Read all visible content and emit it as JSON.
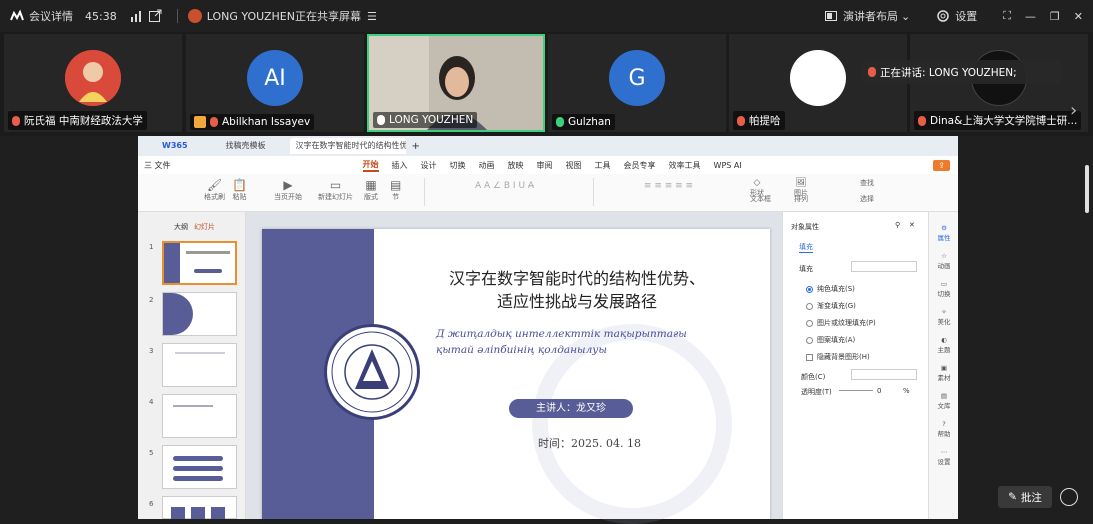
{
  "topbar": {
    "meeting_details": "会议详情",
    "timer": "45:38",
    "sharing_status": "LONG YOUZHEN正在共享屏幕",
    "layout_label": "演讲者布局",
    "settings_label": "设置"
  },
  "participants": [
    {
      "name": "阮氏福 中南财经政法大学",
      "initials": "",
      "avatar_color": "#c9402f"
    },
    {
      "name": "Abilkhan Issayev",
      "initials": "AI",
      "avatar_color": "#2f6fcd"
    },
    {
      "name": "LONG YOUZHEN",
      "initials": "",
      "avatar_color": "#7b7369"
    },
    {
      "name": "Gulzhan",
      "initials": "G",
      "avatar_color": "#2f6fcd"
    },
    {
      "name": "帕提哈",
      "initials": "",
      "avatar_color": "#ffffff"
    },
    {
      "name": "Dina&上海大学文学院博士研...",
      "initials": "",
      "avatar_color": "#111111"
    }
  ],
  "speaking_label": "正在讲话:  LONG YOUZHEN;",
  "wps": {
    "tabs": [
      "W365",
      "找稿壳模板",
      "汉字在数字智能时代的结构性优势"
    ],
    "menu": [
      "三 文件",
      "开始",
      "插入",
      "设计",
      "切换",
      "动画",
      "放映",
      "审阅",
      "视图",
      "工具",
      "会员专享",
      "效率工具",
      "WPS AI"
    ],
    "active_menu": "开始",
    "ribbon": [
      "格式刷",
      "粘贴",
      "当页开始",
      "新建幻灯片",
      "版式",
      "节",
      "形状",
      "图片",
      "文本框",
      "排列",
      "查找",
      "选择"
    ],
    "left_tabs": [
      "大纲",
      "幻灯片"
    ],
    "slide_numbers": [
      "1",
      "2",
      "3",
      "4",
      "5",
      "6"
    ]
  },
  "slide": {
    "title_line1": "汉字在数字智能时代的结构性优势、",
    "title_line2": "适应性挑战与发展路径",
    "kz_line1": "Д   жиҭалдық интеллекттік тақырыптағы",
    "kz_line2": "қытай әліпбиінің қолданылуы",
    "speaker": "主讲人：龙又珍",
    "date": "时间：2025. 04. 18"
  },
  "properties": {
    "header": "对象属性",
    "fill_tab": "填充",
    "fill_section": "填充",
    "options": [
      "纯色填充(S)",
      "渐变填充(G)",
      "图片或纹理填充(P)",
      "图案填充(A)",
      "隐藏背景图形(H)"
    ],
    "selected_option": "纯色填充(S)",
    "color_label": "颜色(C)",
    "transparency_label": "透明度(T)",
    "transparency_value": "0",
    "percent": "%"
  },
  "sidepanel": [
    "属性",
    "动画",
    "切换",
    "美化",
    "主题",
    "素材",
    "文库",
    "帮助",
    "设置"
  ],
  "bottom": {
    "annotate_label": "批注"
  },
  "colors": {
    "slide_accent": "#585d97",
    "wps_active": "#c54c1b",
    "speaking_border": "#3cd07c"
  }
}
